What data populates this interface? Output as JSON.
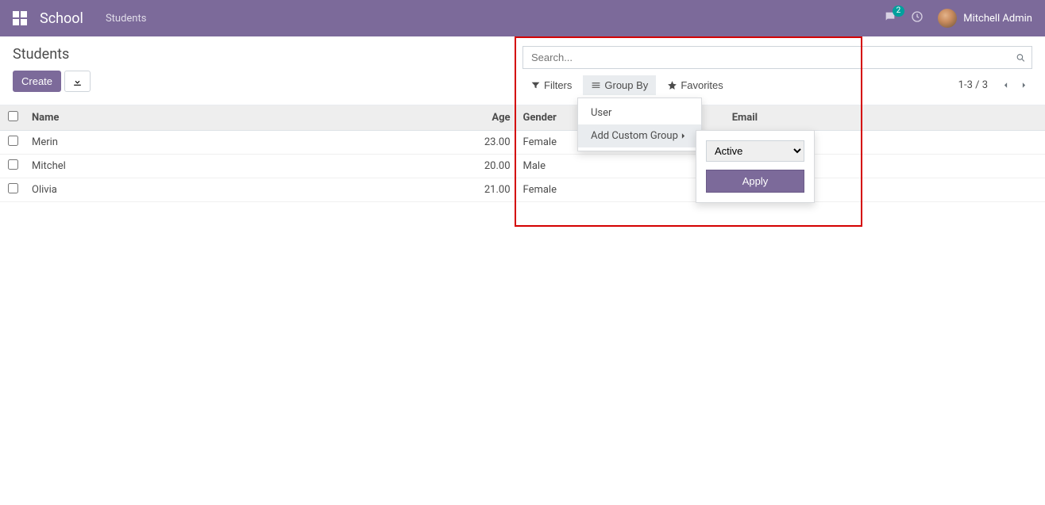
{
  "navbar": {
    "brand": "School",
    "menu_link": "Students",
    "badge_count": "2",
    "user_name": "Mitchell Admin"
  },
  "breadcrumb": {
    "title": "Students"
  },
  "buttons": {
    "create_label": "Create"
  },
  "search": {
    "placeholder": "Search..."
  },
  "search_options": {
    "filters_label": "Filters",
    "groupby_label": "Group By",
    "favorites_label": "Favorites"
  },
  "pager": {
    "range": "1-3 / 3"
  },
  "table": {
    "headers": {
      "name": "Name",
      "age": "Age",
      "gender": "Gender",
      "email": "Email"
    },
    "rows": [
      {
        "name": "Merin",
        "age": "23.00",
        "gender": "Female",
        "email": ""
      },
      {
        "name": "Mitchel",
        "age": "20.00",
        "gender": "Male",
        "email": ""
      },
      {
        "name": "Olivia",
        "age": "21.00",
        "gender": "Female",
        "email": ""
      }
    ]
  },
  "groupby_menu": {
    "item_user": "User",
    "add_custom": "Add Custom Group"
  },
  "custom_group_submenu": {
    "selected_option": "Active",
    "apply_label": "Apply"
  }
}
